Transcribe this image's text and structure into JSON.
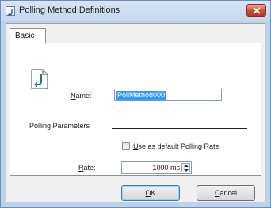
{
  "window": {
    "title": "Polling Method Definitions"
  },
  "tabs": [
    {
      "label": "Basic"
    }
  ],
  "form": {
    "name_label_key": "N",
    "name_label_rest": "ame:",
    "name_value": "PollMethod000",
    "polling_params_label": "Polling Parameters",
    "default_rate_key": "U",
    "default_rate_rest": "se as default Polling Rate",
    "rate_label_key": "R",
    "rate_label_rest": "ate:",
    "rate_value": "1000 ms"
  },
  "buttons": {
    "ok_key": "O",
    "ok_rest": "K",
    "cancel_key": "C",
    "cancel_rest": "ancel"
  }
}
